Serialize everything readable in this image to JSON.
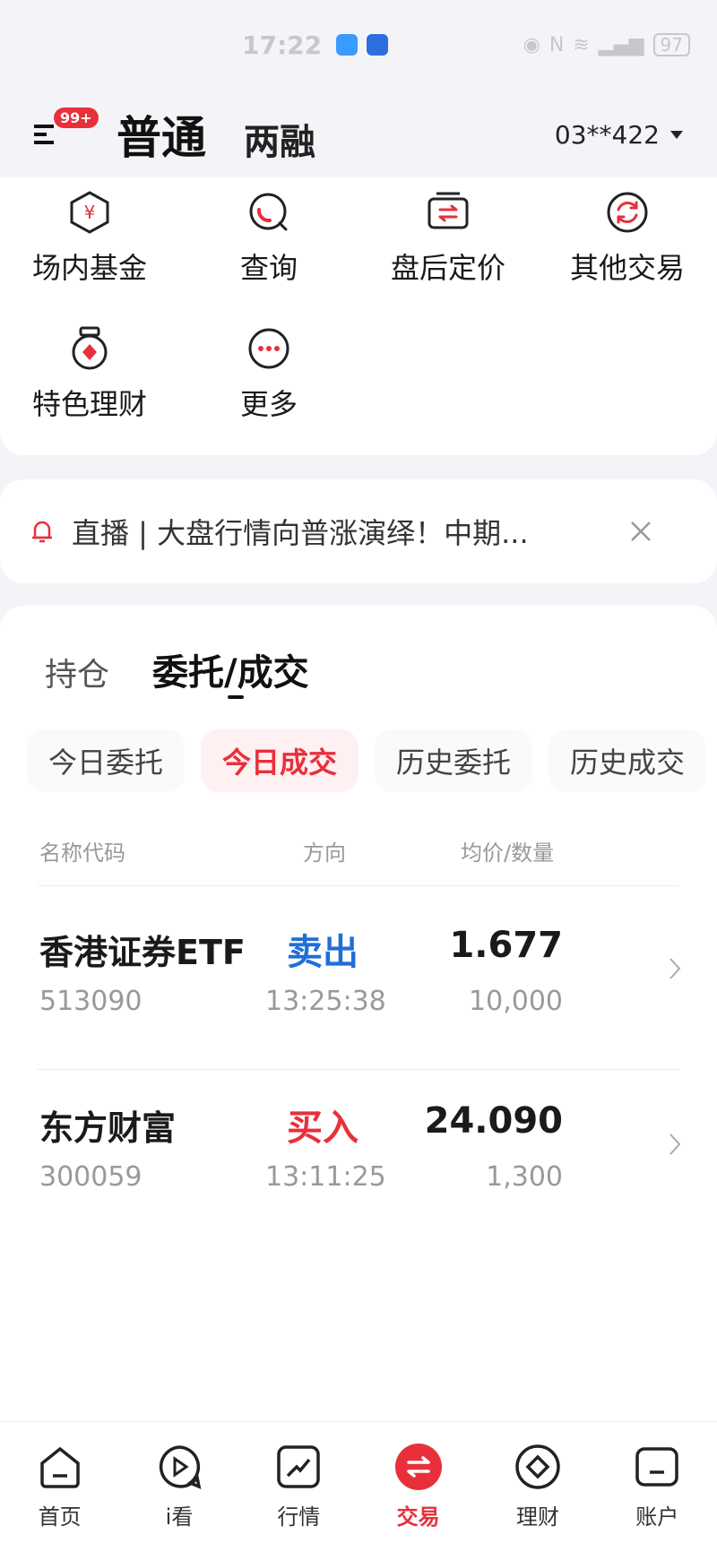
{
  "status": {
    "time": "17:22",
    "battery": "97"
  },
  "header": {
    "badge": "99+",
    "tab_main": "普通",
    "tab_sub": "两融",
    "account": "03**422"
  },
  "shortcuts": [
    {
      "label": "场内基金",
      "icon": "yuan-hexagon-icon"
    },
    {
      "label": "查询",
      "icon": "search-icon"
    },
    {
      "label": "盘后定价",
      "icon": "exchange-card-icon"
    },
    {
      "label": "其他交易",
      "icon": "refresh-circle-icon"
    },
    {
      "label": "特色理财",
      "icon": "medal-icon"
    },
    {
      "label": "更多",
      "icon": "more-dots-icon"
    }
  ],
  "notice": {
    "text": "直播 | 大盘行情向普涨演绎！中期..."
  },
  "main": {
    "tabs": [
      "持仓",
      "委托/成交"
    ],
    "sub_tabs": [
      "今日委托",
      "今日成交",
      "历史委托",
      "历史成交"
    ],
    "columns": {
      "name": "名称代码",
      "direction": "方向",
      "price_qty": "均价/数量"
    },
    "rows": [
      {
        "name": "香港证券ETF",
        "code": "513090",
        "direction": "卖出",
        "time": "13:25:38",
        "price": "1.677",
        "qty": "10,000"
      },
      {
        "name": "东方财富",
        "code": "300059",
        "direction": "买入",
        "time": "13:11:25",
        "price": "24.090",
        "qty": "1,300"
      }
    ]
  },
  "nav": [
    {
      "label": "首页",
      "icon": "home-icon"
    },
    {
      "label": "i看",
      "icon": "play-chat-icon"
    },
    {
      "label": "行情",
      "icon": "trend-chart-icon"
    },
    {
      "label": "交易",
      "icon": "trade-exchange-icon"
    },
    {
      "label": "理财",
      "icon": "diamond-coin-icon"
    },
    {
      "label": "账户",
      "icon": "account-card-icon"
    }
  ],
  "colors": {
    "accent": "#e8303a",
    "sell": "#1f6fd6",
    "buy": "#e8303a"
  }
}
